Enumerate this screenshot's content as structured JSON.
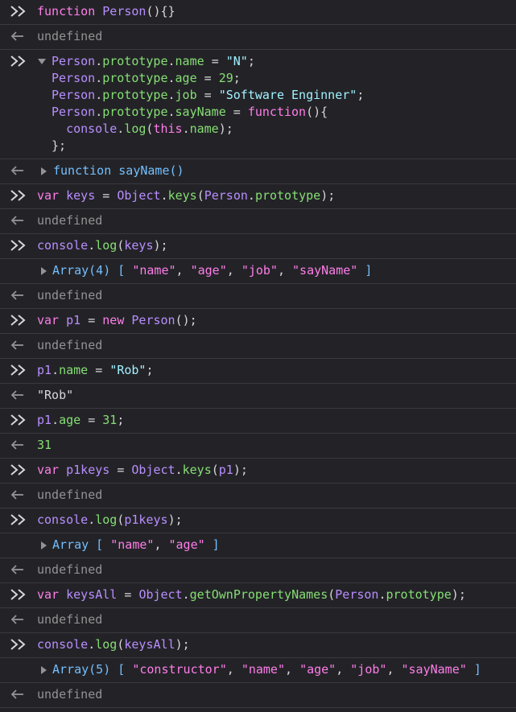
{
  "console": {
    "entries": [
      {
        "kind": "input",
        "lines": [
          "function Person(){}"
        ]
      },
      {
        "kind": "result",
        "text": "undefined"
      },
      {
        "kind": "input",
        "lines": [
          "Person.prototype.name = \"N\";",
          "Person.prototype.age = 29;",
          "Person.prototype.job = \"Software Enginner\";",
          "Person.prototype.sayName = function(){",
          "  console.log(this.name);",
          "};"
        ]
      },
      {
        "kind": "result",
        "text": "function sayName()"
      },
      {
        "kind": "input",
        "lines": [
          "var keys = Object.keys(Person.prototype);"
        ]
      },
      {
        "kind": "result",
        "text": "undefined"
      },
      {
        "kind": "input",
        "lines": [
          "console.log(keys);"
        ]
      },
      {
        "kind": "log",
        "label": "Array(4)",
        "items": [
          "\"name\"",
          "\"age\"",
          "\"job\"",
          "\"sayName\""
        ]
      },
      {
        "kind": "result",
        "text": "undefined"
      },
      {
        "kind": "input",
        "lines": [
          "var p1 = new Person();"
        ]
      },
      {
        "kind": "result",
        "text": "undefined"
      },
      {
        "kind": "input",
        "lines": [
          "p1.name = \"Rob\";"
        ]
      },
      {
        "kind": "result",
        "text": "\"Rob\""
      },
      {
        "kind": "input",
        "lines": [
          "p1.age = 31;"
        ]
      },
      {
        "kind": "result",
        "text": "31"
      },
      {
        "kind": "input",
        "lines": [
          "var p1keys = Object.keys(p1);"
        ]
      },
      {
        "kind": "result",
        "text": "undefined"
      },
      {
        "kind": "input",
        "lines": [
          "console.log(p1keys);"
        ]
      },
      {
        "kind": "log",
        "label": "Array",
        "items": [
          "\"name\"",
          "\"age\""
        ]
      },
      {
        "kind": "result",
        "text": "undefined"
      },
      {
        "kind": "input",
        "lines": [
          "var keysAll = Object.getOwnPropertyNames(Person.prototype);"
        ]
      },
      {
        "kind": "result",
        "text": "undefined"
      },
      {
        "kind": "input",
        "lines": [
          "console.log(keysAll);"
        ]
      },
      {
        "kind": "log",
        "label": "Array(5)",
        "items": [
          "\"constructor\"",
          "\"name\"",
          "\"age\"",
          "\"job\"",
          "\"sayName\""
        ]
      },
      {
        "kind": "result",
        "text": "undefined"
      }
    ]
  },
  "icons": {
    "prompt": "double-chevron-right-icon",
    "result": "arrow-left-icon",
    "expand_collapsed": "triangle-right-icon",
    "expand_open": "triangle-down-icon"
  },
  "colors": {
    "background": "#232327",
    "separator": "#3a3a3e",
    "keyword": "#ff7de9",
    "function_name": "#b98eff",
    "property": "#86de74",
    "string": "#b8e38b",
    "number": "#86de74",
    "undefined": "#939395",
    "object_label": "#75bfff"
  }
}
